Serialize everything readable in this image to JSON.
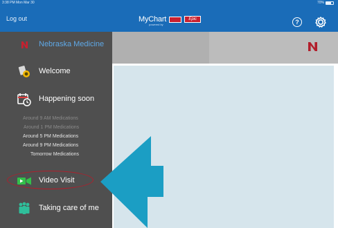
{
  "status_bar": {
    "time": "3:38 PM  Mon Mar 30",
    "battery": "70%",
    "battery_level": 0.7
  },
  "header": {
    "logout_label": "Log out",
    "brand_name": "MyChart",
    "brand_sub": "powered by",
    "brand_epic": "Epic",
    "help_label": "?"
  },
  "sidebar": {
    "org_name": "Nebraska Medicine",
    "welcome_label": "Welcome",
    "happening_label": "Happening soon",
    "schedule": [
      {
        "time": "Around 9 AM",
        "item": "Medications",
        "state": "past"
      },
      {
        "time": "Around 1 PM",
        "item": "Medications",
        "state": "past"
      },
      {
        "time": "Around 5 PM",
        "item": "Medications",
        "state": "upcoming"
      },
      {
        "time": "Around 9 PM",
        "item": "Medications",
        "state": "upcoming"
      },
      {
        "time": "Tomorrow",
        "item": "Medications",
        "state": "upcoming"
      }
    ],
    "video_label": "Video Visit",
    "care_label": "Taking care of me"
  },
  "colors": {
    "header_blue": "#1a6cb8",
    "sidebar_gray": "#4f4f4f",
    "org_link_blue": "#5fa8e6",
    "annotation_red": "#b21e2b",
    "arrow_teal": "#1b9ec4",
    "content_panel": "#d6e5ec"
  },
  "icons": {
    "logo": "nebraska-n-icon",
    "welcome": "welcome-badge-icon",
    "happening": "calendar-clock-icon",
    "video": "video-camera-icon",
    "care": "family-icon",
    "help": "help-circle-icon",
    "settings": "gear-icon"
  }
}
